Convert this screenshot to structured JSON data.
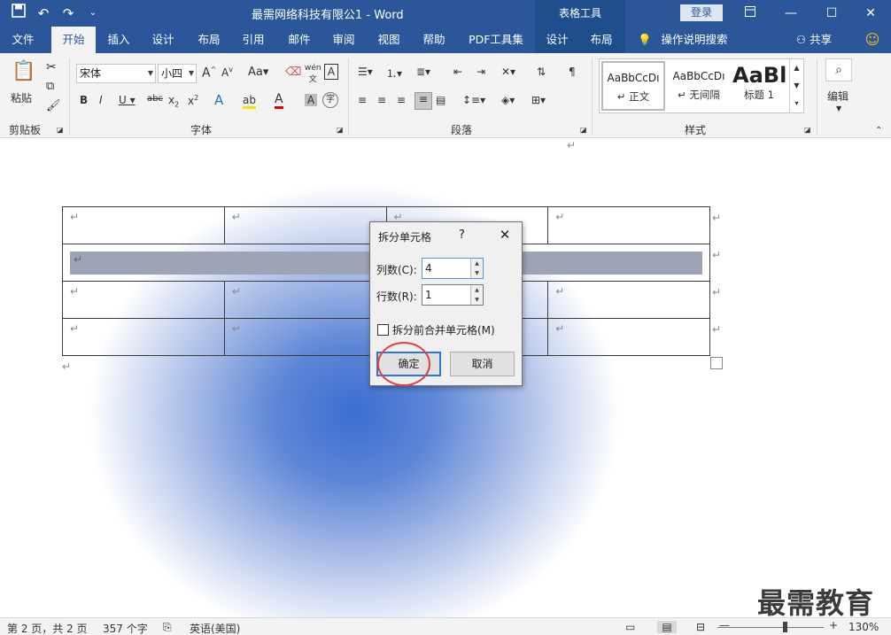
{
  "title_bar": {
    "doc_title": "最需网络科技有限公1  -  Word",
    "context_title": "表格工具",
    "login": "登录",
    "icons": [
      "save-icon",
      "undo-icon",
      "redo-icon",
      "customize-qat-icon"
    ]
  },
  "tabs": [
    {
      "label": "文件"
    },
    {
      "label": "开始"
    },
    {
      "label": "插入"
    },
    {
      "label": "设计"
    },
    {
      "label": "布局"
    },
    {
      "label": "引用"
    },
    {
      "label": "邮件"
    },
    {
      "label": "审阅"
    },
    {
      "label": "视图"
    },
    {
      "label": "帮助"
    },
    {
      "label": "PDF工具集"
    },
    {
      "label": "设计"
    },
    {
      "label": "布局"
    }
  ],
  "tell_me": "操作说明搜索",
  "share": "共享",
  "ribbon": {
    "paste": "粘贴",
    "clipboard_label": "剪贴板",
    "font_name": "宋体",
    "font_size": "小四",
    "font_label": "字体",
    "paragraph_label": "段落",
    "styles_label": "样式",
    "edit_label": "编辑",
    "styles": [
      {
        "sample": "AaBbCcDı",
        "name": "↵ 正文"
      },
      {
        "sample": "AaBbCcDı",
        "name": "↵ 无间隔"
      },
      {
        "sample": "AaBl",
        "name": "标题 1"
      }
    ]
  },
  "dialog": {
    "title": "拆分单元格",
    "help": "?",
    "cols_label": "列数(C):",
    "cols_value": "4",
    "rows_label": "行数(R):",
    "rows_value": "1",
    "merge_label": "拆分前合并单元格(M)",
    "ok": "确定",
    "cancel": "取消"
  },
  "status": {
    "page": "第 2 页，共 2 页",
    "words": "357 个字",
    "language": "英语(美国)",
    "zoom": "130%"
  },
  "watermark": "最需教育",
  "colors": {
    "brand": "#2b579a",
    "highlight": "#e04040"
  }
}
